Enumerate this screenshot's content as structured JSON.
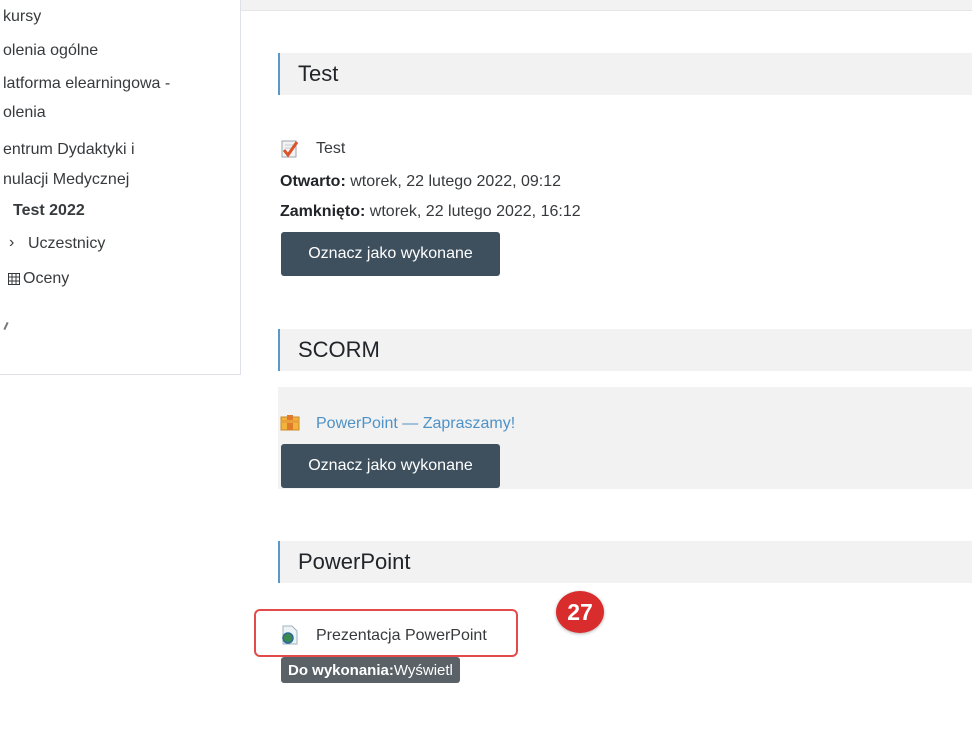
{
  "sidebar": {
    "items": [
      {
        "label": "kursy"
      },
      {
        "label": "olenia ogólne"
      },
      {
        "label": "latforma elearningowa -"
      },
      {
        "label": "olenia"
      },
      {
        "label": "entrum Dydaktyki i"
      },
      {
        "label": "nulacji Medycznej"
      },
      {
        "label": "Test 2022"
      },
      {
        "label": "Uczestnicy"
      },
      {
        "label": "Oceny"
      }
    ]
  },
  "sections": [
    {
      "title": "Test",
      "activity": {
        "name": "Test",
        "icon": "quiz-checkmark-icon"
      },
      "opened_label": "Otwarto:",
      "opened_value": " wtorek, 22 lutego 2022, 09:12",
      "closed_label": "Zamknięto:",
      "closed_value": " wtorek, 22 lutego 2022, 16:12",
      "button": "Oznacz jako wykonane"
    },
    {
      "title": "SCORM",
      "activity": {
        "name": "PowerPoint — Zapraszamy!",
        "icon": "scorm-package-icon"
      },
      "button": "Oznacz jako wykonane"
    },
    {
      "title": "PowerPoint",
      "activity": {
        "name": "Prezentacja PowerPoint",
        "icon": "file-resource-icon"
      },
      "todo_label": "Do wykonania:",
      "todo_value": " Wyświetl"
    }
  ],
  "annotation": {
    "number": "27",
    "color": "#d92c2c"
  },
  "colors": {
    "accent": "#5b97c7",
    "button": "#3e505e",
    "link": "#4f92c6"
  }
}
